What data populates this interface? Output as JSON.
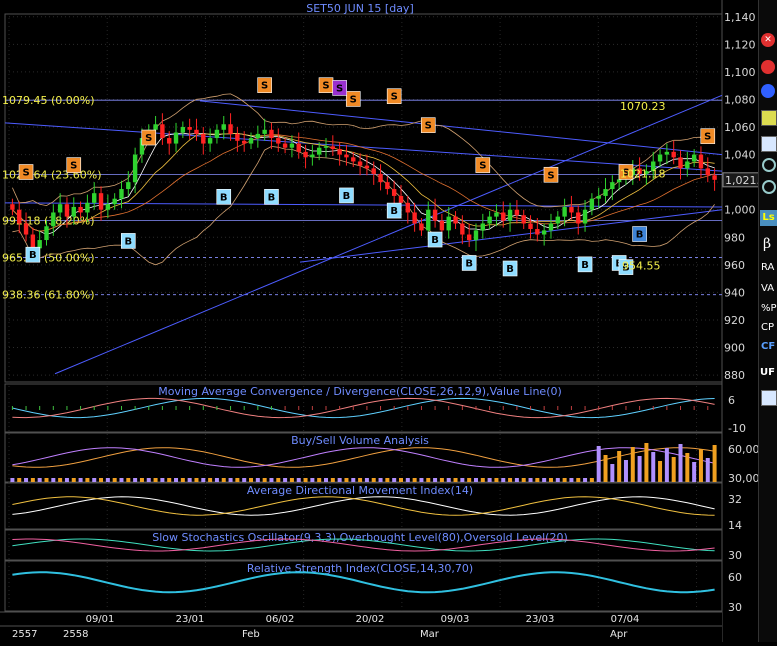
{
  "chart_data": {
    "type": "candlestick",
    "title": "SET50 JUN 15",
    "interval": "[day]",
    "ylim": [
      875,
      1142
    ],
    "y_ticks": [
      "1,140",
      "1,120",
      "1,100",
      "1,080",
      "1,060",
      "1,040",
      "1,020",
      "1,000",
      "980",
      "960",
      "940",
      "920",
      "900",
      "880"
    ],
    "last_price": "1,021.7",
    "x_date_labels": [
      "09/01",
      "23/01",
      "06/02",
      "20/02",
      "09/03",
      "23/03",
      "07/04"
    ],
    "x_year_labels": [
      "2557",
      "2558"
    ],
    "x_month_labels": [
      "Feb",
      "Mar",
      "Apr"
    ],
    "fib_levels": [
      {
        "label": "1079.45 (0.00%)",
        "value": 1079.45
      },
      {
        "label": "1025.64 (23.60%)",
        "value": 1025.64
      },
      {
        "label": "992.18 (38.20%)",
        "value": 992.18
      },
      {
        "label": "965.27 (50.00%)",
        "value": 965.27
      },
      {
        "label": "938.36 (61.80%)",
        "value": 938.36
      }
    ],
    "annotations": [
      {
        "text": "1070.23",
        "value": 1070.23
      },
      {
        "text": "1021.18",
        "value": 1021.18
      },
      {
        "text": "954.55",
        "value": 954.55
      }
    ],
    "signals_sell": [
      {
        "i": 2,
        "price": 1027
      },
      {
        "i": 9,
        "price": 1032
      },
      {
        "i": 20,
        "price": 1052
      },
      {
        "i": 37,
        "price": 1090
      },
      {
        "i": 46,
        "price": 1090
      },
      {
        "i": 50,
        "price": 1080
      },
      {
        "i": 56,
        "price": 1082
      },
      {
        "i": 61,
        "price": 1061
      },
      {
        "i": 69,
        "price": 1032
      },
      {
        "i": 79,
        "price": 1025
      },
      {
        "i": 90,
        "price": 1027
      },
      {
        "i": 102,
        "price": 1053
      }
    ],
    "signal_sell_alt": [
      {
        "i": 48,
        "price": 1088
      }
    ],
    "signals_buy": [
      {
        "i": 3,
        "price": 967
      },
      {
        "i": 17,
        "price": 977
      },
      {
        "i": 31,
        "price": 1009
      },
      {
        "i": 38,
        "price": 1009
      },
      {
        "i": 49,
        "price": 1010
      },
      {
        "i": 56,
        "price": 999
      },
      {
        "i": 62,
        "price": 978
      },
      {
        "i": 67,
        "price": 961
      },
      {
        "i": 73,
        "price": 957
      },
      {
        "i": 84,
        "price": 960
      },
      {
        "i": 89,
        "price": 961
      },
      {
        "i": 90,
        "price": 958
      }
    ],
    "signal_buy_alt": [
      {
        "i": 92,
        "price": 982
      }
    ],
    "closes": [
      1000,
      990,
      982,
      972,
      978,
      988,
      998,
      1004,
      995,
      1002,
      998,
      1005,
      1012,
      1000,
      1004,
      1008,
      1015,
      1020,
      1040,
      1052,
      1058,
      1062,
      1052,
      1048,
      1056,
      1060,
      1058,
      1055,
      1048,
      1052,
      1058,
      1062,
      1055,
      1050,
      1048,
      1052,
      1055,
      1058,
      1052,
      1048,
      1045,
      1048,
      1042,
      1038,
      1040,
      1045,
      1046,
      1044,
      1040,
      1038,
      1035,
      1032,
      1030,
      1026,
      1020,
      1015,
      1010,
      1005,
      998,
      990,
      985,
      1000,
      992,
      985,
      995,
      990,
      982,
      978,
      985,
      990,
      995,
      998,
      992,
      1000,
      996,
      990,
      986,
      982,
      985,
      990,
      995,
      1002,
      998,
      990,
      1000,
      1008,
      1010,
      1015,
      1020,
      1022,
      1025,
      1030,
      1026,
      1028,
      1035,
      1040,
      1042,
      1038,
      1030,
      1035,
      1040,
      1030,
      1025,
      1021.7
    ],
    "panels": [
      {
        "title": "Moving Average Convergence / Divergence(CLOSE,26,12,9),Value Line(0)",
        "ticks": [
          "6",
          "-10"
        ]
      },
      {
        "title": "Buy/Sell Volume Analysis",
        "ticks": [
          "60,00",
          "30,00"
        ]
      },
      {
        "title": "Average Directional Movement Index(14)",
        "ticks": [
          "32",
          "14"
        ]
      },
      {
        "title": "Slow Stochastics Oscillator(9,3,3),Overbought Level(80),Oversold Level(20)",
        "ticks": [
          "30"
        ]
      },
      {
        "title": "Relative Strength Index(CLOSE,14,30,70)",
        "ticks": [
          "60",
          "30"
        ]
      }
    ]
  },
  "right_toolbar": {
    "symbols": [
      "β",
      "RA",
      "VA",
      "%P",
      "CP",
      "CF",
      "UF"
    ]
  },
  "colors": {
    "bg": "#000000",
    "grid": "#3a3a3a",
    "up": "#2fd32f",
    "down": "#ff2222",
    "sell": "#f08a25",
    "buy": "#8fdcff",
    "fib": "#8890ff",
    "trend": "#4d5cff"
  }
}
